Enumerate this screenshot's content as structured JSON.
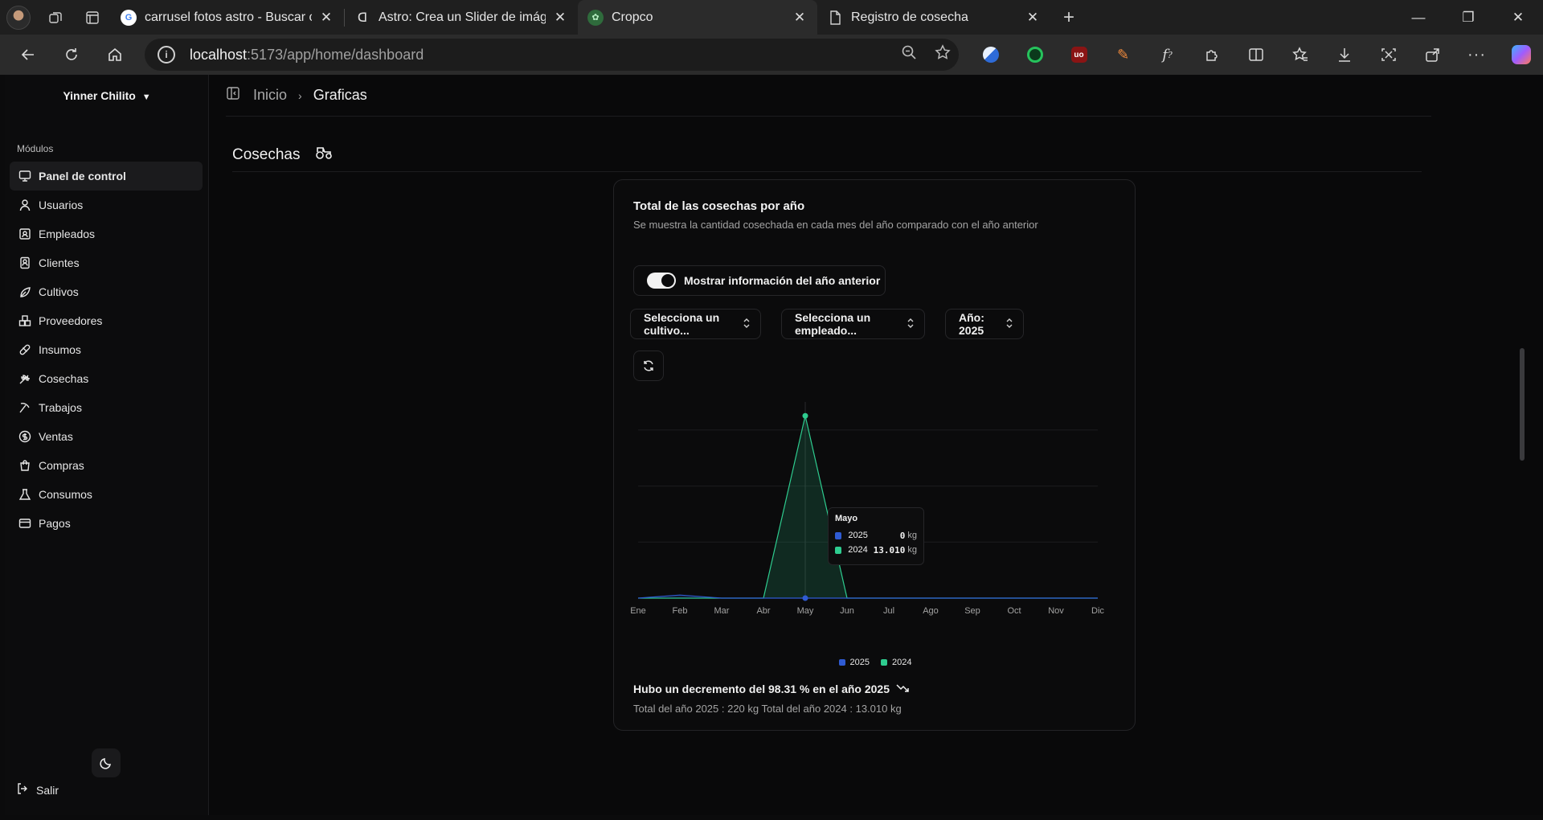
{
  "browser": {
    "tabs": [
      {
        "title": "carrusel fotos astro - Buscar con C",
        "icon": "google-icon"
      },
      {
        "title": "Astro: Crea un Slider de imágenes",
        "icon": "astro-icon"
      },
      {
        "title": "Cropco",
        "icon": "cropco-leaf-icon",
        "active": true
      },
      {
        "title": "Registro de cosecha",
        "icon": "page-icon"
      }
    ],
    "url_host": "localhost",
    "url_path": ":5173/app/home/dashboard"
  },
  "sidebar": {
    "user": "Yinner Chilito",
    "section_label": "Módulos",
    "items": [
      {
        "label": "Panel de control",
        "icon": "monitor-icon"
      },
      {
        "label": "Usuarios",
        "icon": "user-icon"
      },
      {
        "label": "Empleados",
        "icon": "id-card-icon"
      },
      {
        "label": "Clientes",
        "icon": "contact-icon"
      },
      {
        "label": "Cultivos",
        "icon": "sprout-icon"
      },
      {
        "label": "Proveedores",
        "icon": "boxes-icon"
      },
      {
        "label": "Insumos",
        "icon": "pill-icon"
      },
      {
        "label": "Cosechas",
        "icon": "wheat-icon"
      },
      {
        "label": "Trabajos",
        "icon": "pickaxe-icon"
      },
      {
        "label": "Ventas",
        "icon": "dollar-icon"
      },
      {
        "label": "Compras",
        "icon": "shopping-bag-icon"
      },
      {
        "label": "Consumos",
        "icon": "flask-icon"
      },
      {
        "label": "Pagos",
        "icon": "credit-card-icon"
      }
    ],
    "logout_label": "Salir"
  },
  "breadcrumb": {
    "first": "Inicio",
    "second": "Graficas"
  },
  "page": {
    "title": "Cosechas"
  },
  "card": {
    "title": "Total de las cosechas por año",
    "subtitle": "Se muestra la cantidad cosechada en cada mes del año comparado con el año anterior",
    "toggle_label": "Mostrar información del año anterior",
    "toggle_on": true,
    "select_crop": "Selecciona un cultivo...",
    "select_employee": "Selecciona un empleado...",
    "select_year": "Año: 2025",
    "footer_trend": "Hubo un decremento del 98.31 % en el año 2025",
    "footer_totals": "Total del año 2025 : 220 kg  Total del año 2024 :  13.010 kg"
  },
  "tooltip": {
    "title": "Mayo",
    "rows": [
      {
        "year": "2025",
        "value": "0",
        "unit": "kg"
      },
      {
        "year": "2024",
        "value": "13.010",
        "unit": "kg"
      }
    ]
  },
  "colors": {
    "series_2025": "#2f5bd3",
    "series_2024": "#2ecc8f"
  },
  "chart_data": {
    "type": "area",
    "categories": [
      "Ene",
      "Feb",
      "Mar",
      "Abr",
      "May",
      "Jun",
      "Jul",
      "Ago",
      "Sep",
      "Oct",
      "Nov",
      "Dic"
    ],
    "series": [
      {
        "name": "2025",
        "values": [
          0,
          220,
          0,
          0,
          0,
          0,
          0,
          0,
          0,
          0,
          0,
          0
        ]
      },
      {
        "name": "2024",
        "values": [
          0,
          0,
          0,
          0,
          13010,
          0,
          0,
          0,
          0,
          0,
          0,
          0
        ]
      }
    ],
    "ylim": [
      0,
      14000
    ],
    "grid": true,
    "legend": "bottom"
  }
}
